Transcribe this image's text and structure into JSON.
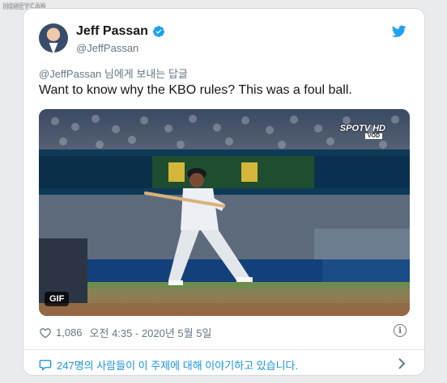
{
  "watermark": "HONEYCAM",
  "tweet": {
    "author_name": "Jeff Passan",
    "author_handle": "@JeffPassan",
    "reply_to": "@JeffPassan 님에게 보내는 답글",
    "text": "Want to know why the KBO rules? This was a foul ball.",
    "media": {
      "type_badge": "GIF",
      "broadcaster_logo": "SPOTV HD",
      "broadcaster_sub": "VOD",
      "scoreboard_logo": "MyKBO"
    },
    "likes": "1,086",
    "timestamp": "오전 4:35 - 2020년 5월 5일",
    "conversation": "247명의 사람들이 이 주제에 대해 이야기하고 있습니다."
  },
  "colors": {
    "accent": "#1da1f2",
    "link": "#1b95e0",
    "muted": "#657786",
    "text": "#14171a"
  },
  "icons": {
    "verified": "verified-badge-icon",
    "brand": "twitter-bird-icon",
    "like": "heart-icon",
    "info": "info-icon",
    "conversation": "speech-bubble-icon",
    "chevron": "chevron-right-icon"
  }
}
